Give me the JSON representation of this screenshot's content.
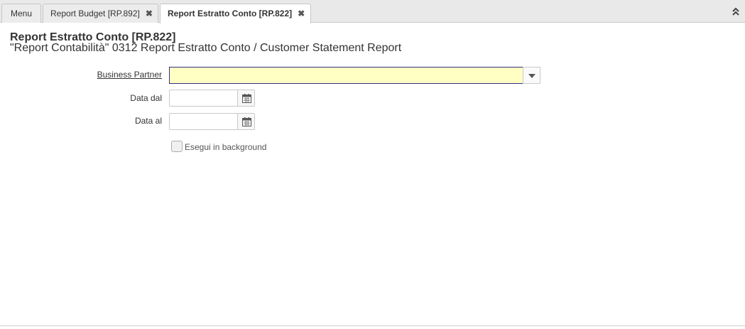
{
  "tabs": [
    {
      "label": "Menu"
    },
    {
      "label": "Report Budget [RP.892]",
      "close_icon": "close-icon"
    },
    {
      "label": "Report Estratto Conto [RP.822]",
      "close_icon": "close-icon"
    }
  ],
  "header": {
    "title": "Report Estratto Conto [RP.822]",
    "subtitle": "\"Report Contabilità\" 0312 Report Estratto Conto / Customer Statement Report"
  },
  "form": {
    "business_partner_label": "Business Partner",
    "business_partner_value": "",
    "data_dal_label": "Data dal",
    "data_dal_value": "",
    "data_al_label": "Data al",
    "data_al_value": "",
    "background_label": "Esegui in background",
    "background_checked": false
  },
  "colors": {
    "focused_field": "#ffffc4",
    "tabbar": "#e9e9e9"
  }
}
